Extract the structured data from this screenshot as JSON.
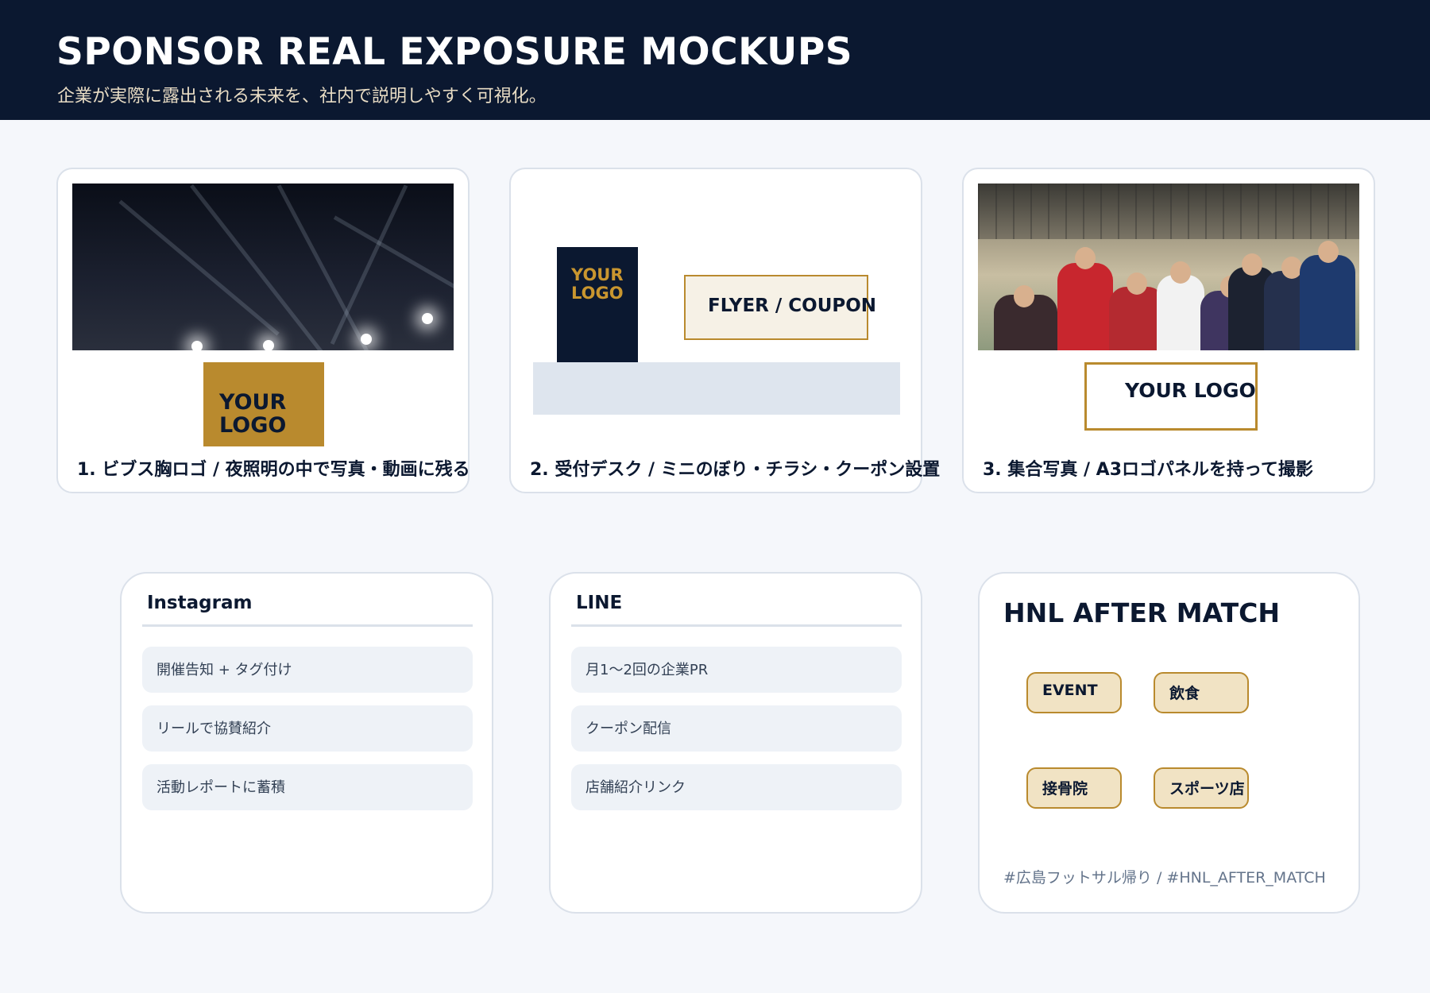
{
  "header": {
    "title": "SPONSOR REAL EXPOSURE MOCKUPS",
    "subtitle": "企業が実際に露出される未来を、社内で説明しやすく可視化。"
  },
  "mockups": [
    {
      "caption": "1. ビブス胸ロゴ / 夜照明の中で写真・動画に残る",
      "logo_line1": "YOUR",
      "logo_line2": "LOGO"
    },
    {
      "caption": "2. 受付デスク / ミニのぼり・チラシ・クーポン設置",
      "banner_line1": "YOUR",
      "banner_line2": "LOGO",
      "flyer": "FLYER / COUPON"
    },
    {
      "caption": "3. 集合写真 / A3ロゴパネルを持って撮影",
      "panel": "YOUR LOGO"
    }
  ],
  "channels": {
    "instagram": {
      "title": "Instagram",
      "items": [
        "開催告知 + タグ付け",
        "リールで協賛紹介",
        "活動レポートに蓄積"
      ]
    },
    "line": {
      "title": "LINE",
      "items": [
        "月1〜2回の企業PR",
        "クーポン配信",
        "店舗紹介リンク"
      ]
    },
    "hnl": {
      "title": "HNL AFTER MATCH",
      "chips": [
        "EVENT",
        "飲食",
        "接骨院",
        "スポーツ店"
      ],
      "hashtag": "#広島フットサル帰り / #HNL_AFTER_MATCH"
    }
  },
  "colors": {
    "navy": "#0b1830",
    "gold": "#b98a2e",
    "background": "#f5f7fb"
  }
}
